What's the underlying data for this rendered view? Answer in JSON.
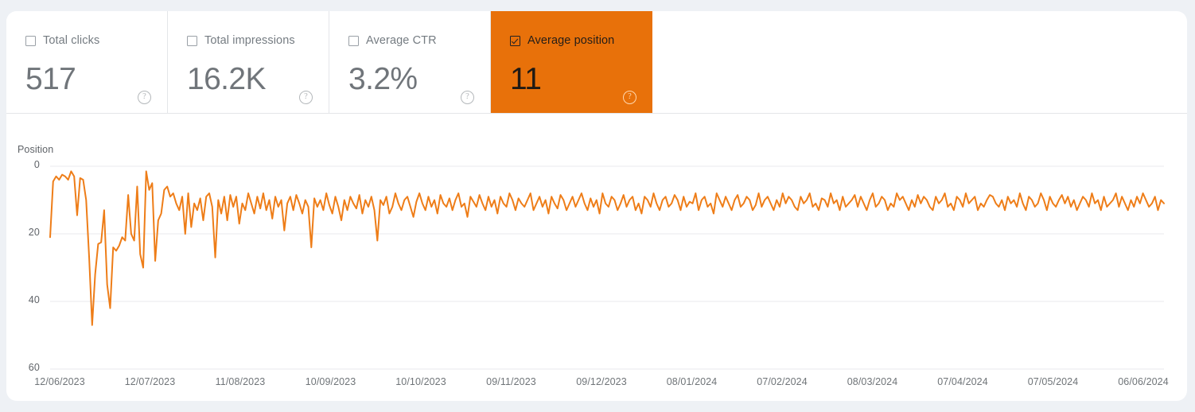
{
  "metrics": [
    {
      "label": "Total clicks",
      "value": "517",
      "checked": false,
      "help": "?"
    },
    {
      "label": "Total impressions",
      "value": "16.2K",
      "checked": false,
      "help": "?"
    },
    {
      "label": "Average CTR",
      "value": "3.2%",
      "checked": false,
      "help": "?"
    },
    {
      "label": "Average position",
      "value": "11",
      "checked": true,
      "help": "?"
    }
  ],
  "colors": {
    "accent": "#e8710a",
    "line": "#ee7d18",
    "grid": "#e8eaed",
    "page_background": "#eef1f5",
    "panel_background": "#ffffff",
    "text_muted": "#5f6368"
  },
  "chart_data": {
    "type": "line",
    "title": "",
    "ylabel": "Position",
    "xlabel": "",
    "ylim": [
      0,
      60
    ],
    "y_inverted": true,
    "grid": true,
    "legend": "none",
    "yticks": [
      "0",
      "20",
      "40",
      "60"
    ],
    "ytick_values": [
      0,
      20,
      40,
      60
    ],
    "categories": [
      "12/06/2023",
      "12/07/2023",
      "11/08/2023",
      "10/09/2023",
      "10/10/2023",
      "09/11/2023",
      "09/12/2023",
      "08/01/2024",
      "07/02/2024",
      "08/03/2024",
      "07/04/2024",
      "07/05/2024",
      "06/06/2024"
    ],
    "series": [
      {
        "name": "Average position",
        "color": "#ee7d18",
        "values": [
          21.0,
          4.5,
          3.0,
          4.0,
          2.5,
          3.0,
          4.0,
          1.5,
          3.0,
          14.5,
          3.5,
          4.0,
          10.0,
          27.0,
          47.0,
          32.0,
          23.0,
          22.5,
          13.0,
          35.0,
          42.0,
          24.0,
          25.0,
          23.5,
          21.0,
          22.0,
          8.5,
          20.0,
          22.0,
          6.0,
          26.0,
          30.0,
          1.5,
          7.0,
          5.0,
          28.0,
          16.0,
          14.0,
          7.0,
          6.0,
          9.0,
          8.0,
          11.0,
          13.0,
          9.0,
          20.0,
          8.0,
          18.0,
          11.0,
          13.0,
          9.5,
          16.0,
          9.0,
          8.0,
          12.0,
          27.0,
          10.0,
          14.0,
          9.0,
          16.0,
          8.5,
          12.0,
          9.0,
          17.0,
          11.0,
          13.0,
          8.0,
          11.0,
          14.0,
          9.0,
          12.5,
          8.0,
          13.0,
          10.0,
          15.5,
          9.0,
          12.0,
          10.0,
          19.0,
          11.0,
          9.0,
          13.0,
          8.5,
          11.0,
          14.0,
          10.0,
          12.0,
          24.0,
          9.5,
          12.0,
          10.0,
          13.0,
          8.0,
          11.5,
          14.0,
          9.0,
          12.0,
          16.0,
          10.0,
          13.0,
          9.0,
          11.0,
          12.5,
          8.5,
          14.0,
          10.0,
          12.0,
          9.0,
          13.0,
          22.0,
          10.0,
          11.5,
          9.0,
          14.0,
          12.0,
          8.0,
          11.0,
          13.0,
          10.0,
          9.0,
          12.0,
          15.0,
          10.5,
          8.0,
          11.0,
          13.0,
          9.0,
          12.0,
          10.0,
          14.0,
          8.5,
          11.0,
          12.0,
          9.5,
          13.0,
          10.0,
          8.0,
          12.0,
          11.0,
          15.0,
          9.0,
          10.5,
          12.0,
          8.5,
          11.0,
          13.0,
          9.0,
          12.0,
          10.0,
          14.0,
          9.0,
          11.0,
          12.0,
          8.0,
          10.0,
          13.0,
          9.5,
          11.0,
          12.0,
          10.0,
          8.0,
          13.0,
          11.0,
          9.0,
          12.0,
          10.0,
          14.0,
          9.0,
          11.0,
          12.5,
          8.5,
          10.0,
          13.0,
          11.0,
          9.0,
          12.0,
          10.0,
          8.0,
          11.0,
          13.0,
          9.5,
          12.0,
          10.0,
          14.0,
          8.0,
          11.0,
          12.0,
          9.0,
          10.0,
          13.0,
          11.0,
          8.5,
          12.0,
          10.0,
          9.0,
          13.0,
          11.0,
          14.0,
          9.0,
          10.0,
          12.0,
          8.0,
          11.0,
          13.0,
          10.0,
          9.0,
          12.0,
          11.0,
          8.5,
          10.0,
          13.0,
          9.0,
          12.0,
          10.5,
          11.0,
          8.0,
          13.0,
          10.0,
          9.0,
          12.0,
          11.0,
          14.0,
          8.0,
          10.0,
          12.0,
          9.0,
          11.0,
          13.0,
          10.0,
          8.5,
          12.0,
          11.0,
          9.0,
          10.0,
          13.0,
          11.5,
          8.0,
          12.0,
          10.0,
          9.0,
          11.0,
          13.0,
          10.0,
          12.0,
          8.0,
          11.0,
          9.0,
          10.0,
          12.0,
          13.0,
          9.0,
          11.0,
          10.0,
          8.0,
          12.0,
          11.0,
          13.0,
          9.5,
          10.0,
          12.0,
          8.0,
          11.0,
          10.0,
          13.0,
          9.0,
          12.0,
          11.0,
          10.0,
          8.5,
          12.0,
          9.0,
          11.0,
          13.0,
          10.0,
          8.0,
          12.0,
          11.0,
          9.0,
          10.0,
          13.0,
          11.0,
          12.0,
          8.0,
          10.0,
          9.0,
          11.0,
          13.0,
          10.0,
          12.0,
          8.5,
          11.0,
          9.0,
          10.0,
          12.0,
          13.0,
          9.0,
          11.0,
          10.0,
          8.0,
          12.0,
          11.0,
          13.0,
          9.0,
          10.0,
          12.0,
          8.0,
          11.0,
          10.0,
          9.0,
          13.0,
          11.0,
          12.0,
          10.0,
          8.5,
          9.0,
          11.0,
          12.0,
          10.0,
          13.0,
          9.0,
          11.0,
          10.0,
          12.0,
          8.0,
          11.0,
          13.0,
          9.0,
          10.0,
          12.0,
          11.0,
          8.0,
          10.0,
          13.0,
          9.0,
          11.0,
          12.0,
          10.0,
          8.5,
          11.0,
          9.0,
          12.0,
          10.0,
          13.0,
          11.0,
          9.0,
          10.0,
          12.0,
          8.0,
          11.0,
          10.0,
          13.0,
          9.0,
          12.0,
          11.0,
          10.0,
          8.0,
          12.0,
          9.0,
          11.0,
          13.0,
          10.0,
          12.0,
          9.0,
          11.0,
          8.0,
          10.0,
          12.0,
          11.0,
          9.0,
          13.0,
          10.0,
          11.0
        ]
      }
    ]
  }
}
